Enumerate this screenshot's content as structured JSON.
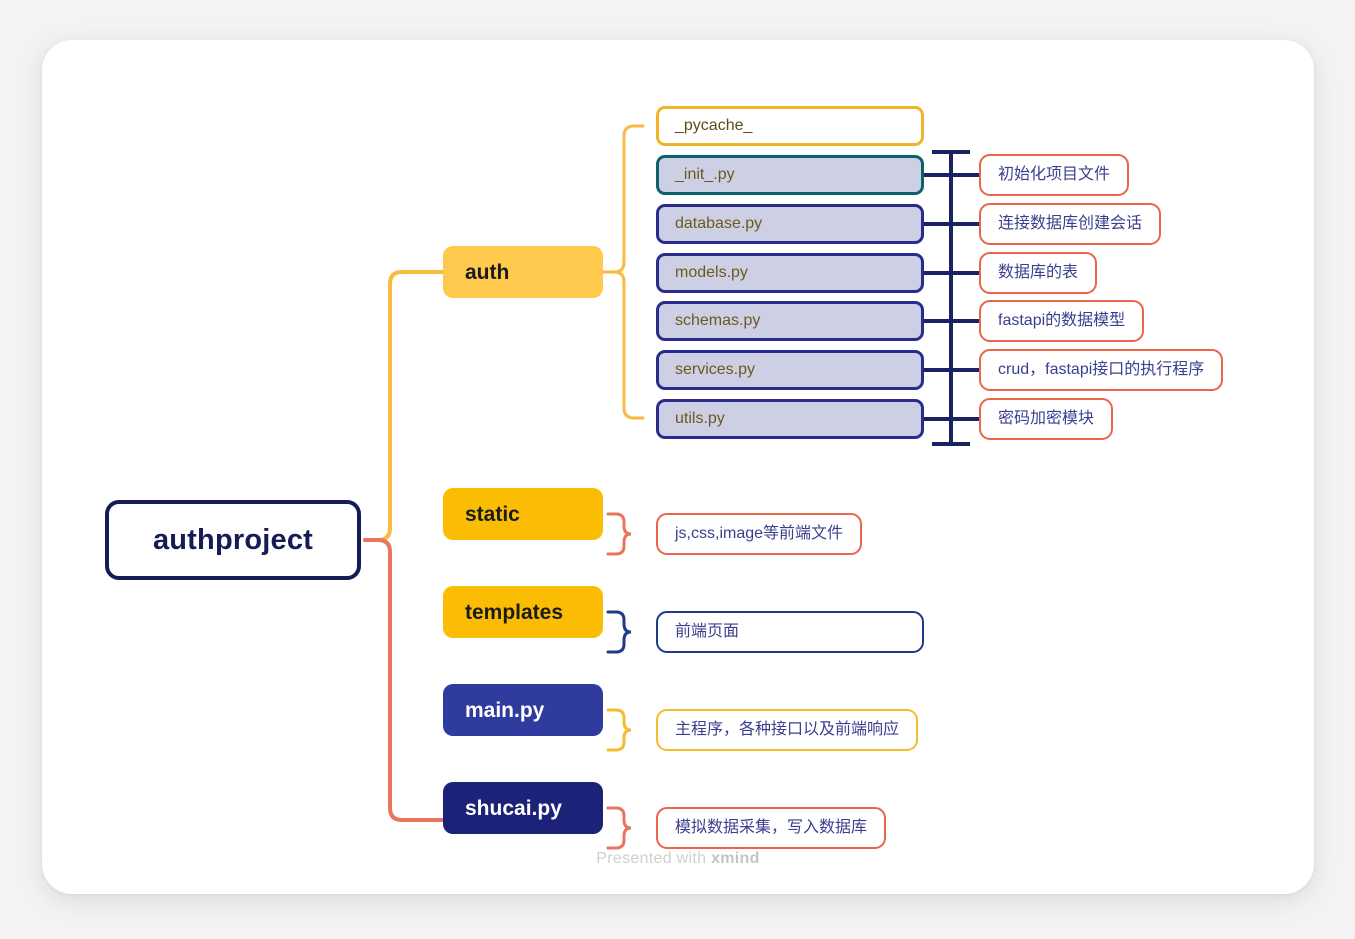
{
  "canvas": {
    "background_color": "#f3f3f3",
    "card_color": "#ffffff"
  },
  "watermark": {
    "prefix": "Presented with ",
    "brand": "xmind"
  },
  "root": {
    "label": "authproject",
    "border_color": "#151b54",
    "text_color": "#151b54"
  },
  "branches": [
    {
      "id": "auth",
      "label": "auth",
      "fill_color": "#ffc94d",
      "text_color": "#1b1b1b",
      "trunk_color": "#f7bc3f",
      "children": [
        {
          "label": "_pycache_",
          "fill_color": "#ffffff",
          "border_color": "#f0b429",
          "note": null
        },
        {
          "label": "_init_.py",
          "fill_color": "#cdcfe4",
          "border_color": "#0d6168",
          "note": {
            "text": "初始化项目文件",
            "border_color": "#e8664a"
          }
        },
        {
          "label": "database.py",
          "fill_color": "#cdcfe4",
          "border_color": "#2a2c8c",
          "note": {
            "text": "连接数据库创建会话",
            "border_color": "#e8664a"
          }
        },
        {
          "label": "models.py",
          "fill_color": "#cdcfe4",
          "border_color": "#2a2c8c",
          "note": {
            "text": "数据库的表",
            "border_color": "#e8664a"
          }
        },
        {
          "label": "schemas.py",
          "fill_color": "#cdcfe4",
          "border_color": "#2a2c8c",
          "note": {
            "text": "fastapi的数据模型",
            "border_color": "#e8664a"
          }
        },
        {
          "label": "services.py",
          "fill_color": "#cdcfe4",
          "border_color": "#2a2c8c",
          "note": {
            "text": "crud，fastapi接口的执行程序",
            "border_color": "#e8664a"
          }
        },
        {
          "label": "utils.py",
          "fill_color": "#cdcfe4",
          "border_color": "#2a2c8c",
          "note": {
            "text": "密码加密模块",
            "border_color": "#e8664a"
          }
        }
      ]
    },
    {
      "id": "static",
      "label": "static",
      "fill_color": "#fbbc04",
      "text_color": "#1b1b1b",
      "brace_color": "#e8664a",
      "note": {
        "text": "js,css,image等前端文件",
        "border_color": "#e8664a"
      }
    },
    {
      "id": "templates",
      "label": "templates",
      "fill_color": "#fbbc04",
      "text_color": "#1b1b1b",
      "brace_color": "#1f3a8a",
      "note": {
        "text": "前端页面",
        "border_color": "#1f3a8a"
      }
    },
    {
      "id": "main",
      "label": "main.py",
      "fill_color": "#2f3b9e",
      "text_color": "#ffffff",
      "brace_color": "#f5bc2e",
      "note": {
        "text": "主程序，各种接口以及前端响应",
        "border_color": "#f5bc2e"
      }
    },
    {
      "id": "shucai",
      "label": "shucai.py",
      "fill_color": "#1d2279",
      "text_color": "#ffffff",
      "brace_color": "#e8664a",
      "note": {
        "text": "模拟数据采集，写入数据库",
        "border_color": "#e8664a"
      }
    }
  ]
}
